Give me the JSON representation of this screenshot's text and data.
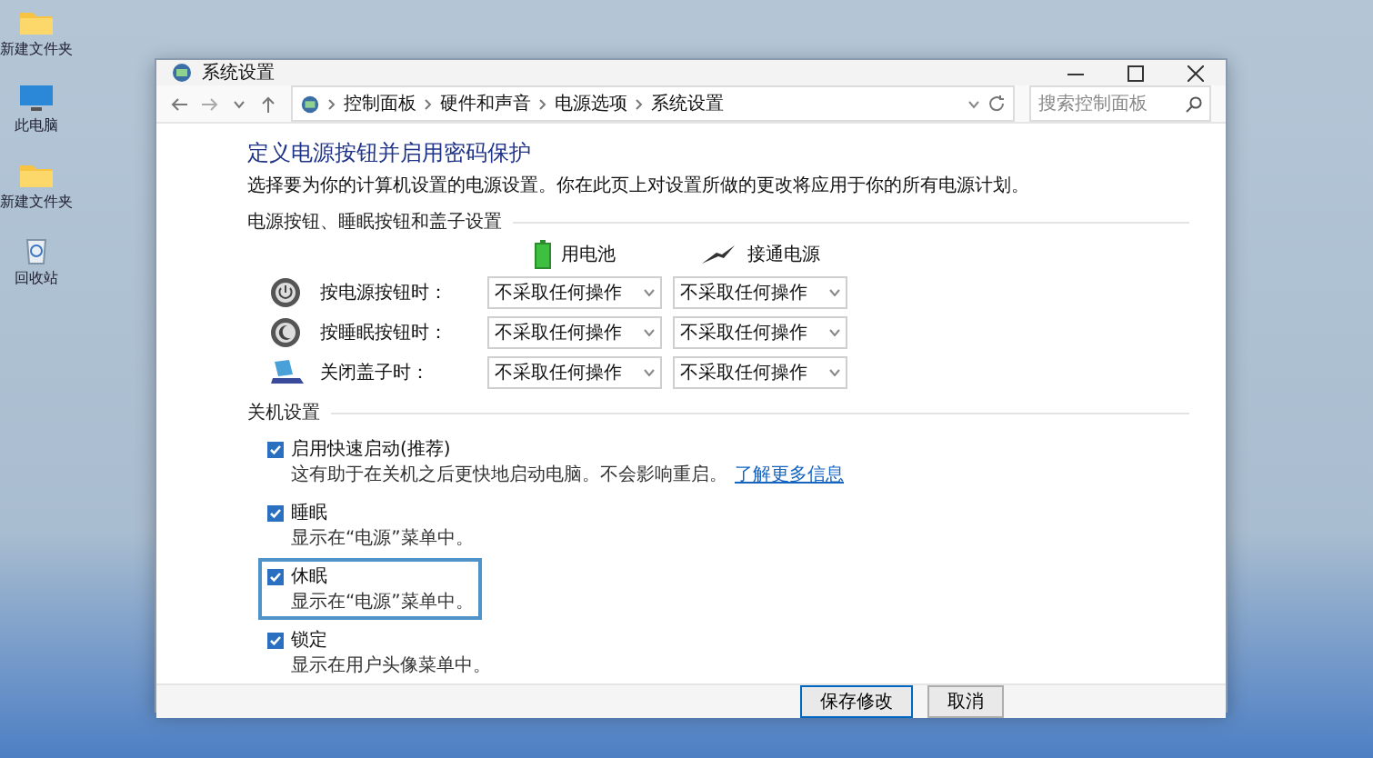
{
  "desktop_icons": [
    {
      "label": "新建文件夹",
      "kind": "folder"
    },
    {
      "label": "此电脑",
      "kind": "monitor"
    },
    {
      "label": "新建文件夹",
      "kind": "folder"
    },
    {
      "label": "回收站",
      "kind": "recycle"
    }
  ],
  "window": {
    "title": "系统设置"
  },
  "address_bar": {
    "breadcrumbs": [
      "控制面板",
      "硬件和声音",
      "电源选项",
      "系统设置"
    ]
  },
  "search": {
    "placeholder": "搜索控制面板"
  },
  "page": {
    "heading": "定义电源按钮并启用密码保护",
    "description": "选择要为你的计算机设置的电源设置。你在此页上对设置所做的更改将应用于你的所有电源计划。",
    "power_section": {
      "title": "电源按钮、睡眠按钮和盖子设置",
      "columns": [
        {
          "label": "用电池",
          "kind": "battery"
        },
        {
          "label": "接通电源",
          "kind": "plug"
        }
      ],
      "rows": [
        {
          "label": "按电源按钮时：",
          "kind": "power",
          "values": [
            "不采取任何操作",
            "不采取任何操作"
          ]
        },
        {
          "label": "按睡眠按钮时：",
          "kind": "sleep",
          "values": [
            "不采取任何操作",
            "不采取任何操作"
          ]
        },
        {
          "label": "关闭盖子时：",
          "kind": "lid",
          "values": [
            "不采取任何操作",
            "不采取任何操作"
          ]
        }
      ]
    },
    "shutdown_section": {
      "title": "关机设置",
      "items": [
        {
          "label": "启用快速启动(推荐)",
          "description": "这有助于在关机之后更快地启动电脑。不会影响重启。",
          "link": "了解更多信息",
          "checked": true,
          "highlighted": false
        },
        {
          "label": "睡眠",
          "description": "显示在“电源”菜单中。",
          "checked": true,
          "highlighted": false
        },
        {
          "label": "休眠",
          "description": "显示在“电源”菜单中。",
          "checked": true,
          "highlighted": true
        },
        {
          "label": "锁定",
          "description": "显示在用户头像菜单中。",
          "checked": true,
          "highlighted": false
        }
      ]
    }
  },
  "footer": {
    "buttons": [
      "保存修改",
      "取消"
    ]
  }
}
